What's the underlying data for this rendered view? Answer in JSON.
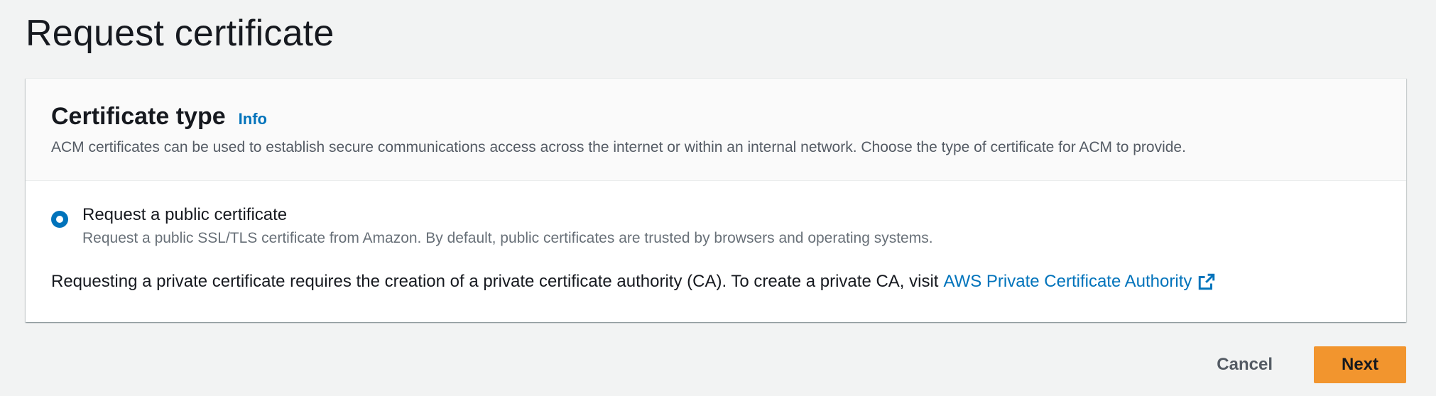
{
  "page": {
    "title": "Request certificate"
  },
  "certificate_type": {
    "title": "Certificate type",
    "info_label": "Info",
    "description": "ACM certificates can be used to establish secure communications access across the internet or within an internal network. Choose the type of certificate for ACM to provide.",
    "option": {
      "label": "Request a public certificate",
      "description": "Request a public SSL/TLS certificate from Amazon. By default, public certificates are trusted by browsers and operating systems.",
      "selected": true
    },
    "private_note": "Requesting a private certificate requires the creation of a private certificate authority (CA). To create a private CA, visit",
    "private_link": "AWS Private Certificate Authority",
    "external_icon": "external-link-icon"
  },
  "actions": {
    "cancel_label": "Cancel",
    "next_label": "Next"
  },
  "colors": {
    "link": "#0073bb",
    "primary_button": "#f2952e",
    "background": "#f2f3f3"
  }
}
